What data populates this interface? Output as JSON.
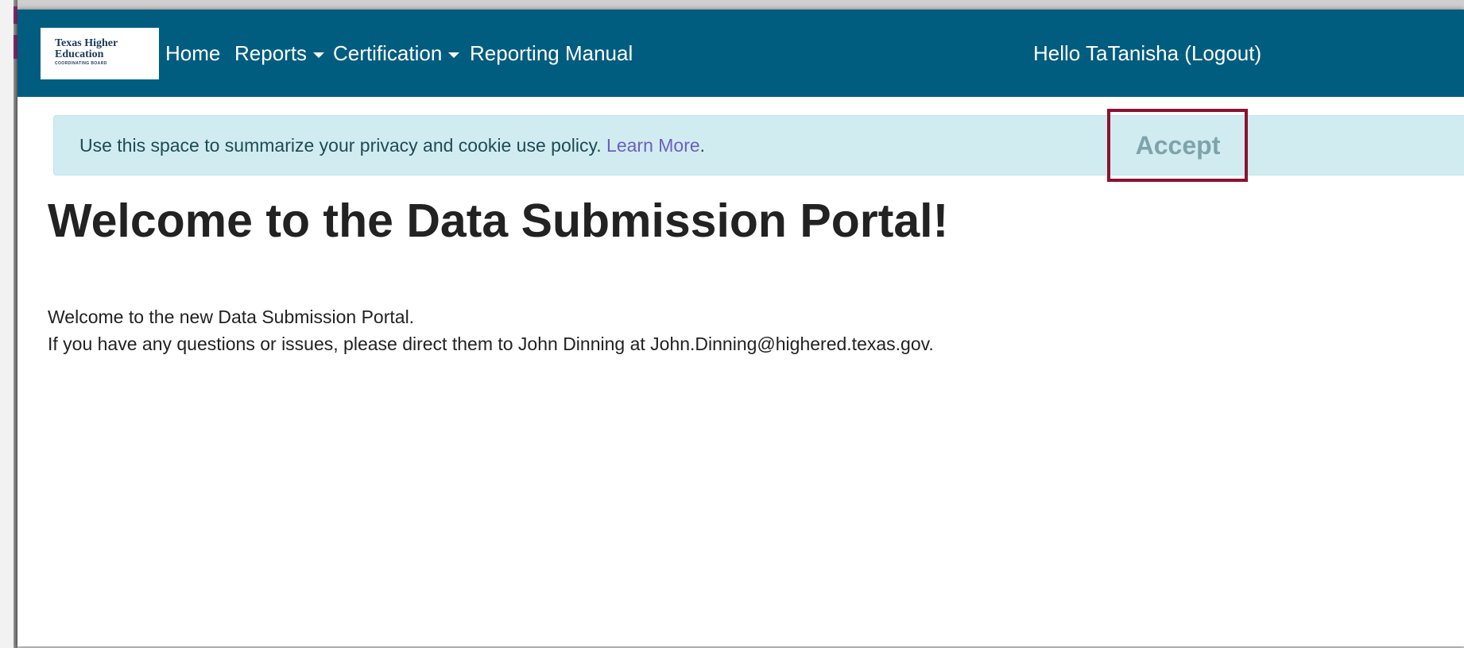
{
  "header": {
    "logo": {
      "line1": "Texas Higher",
      "line2": "Education",
      "line3": "COORDINATING BOARD"
    },
    "nav": {
      "home": "Home",
      "reports": "Reports",
      "certification": "Certification",
      "reporting_manual": "Reporting Manual"
    },
    "greeting": "Hello TaTanisha (Logout)",
    "icons": {
      "reports_dropdown": "caret-down-icon",
      "certification_dropdown": "caret-down-icon"
    }
  },
  "cookie_banner": {
    "message": "Use this space to summarize your privacy and cookie use policy.",
    "link_label": "Learn More",
    "trailing": ".",
    "accept_label": "Accept"
  },
  "main": {
    "title": "Welcome to the Data Submission Portal!",
    "line1": "Welcome to the new Data Submission Portal.",
    "line2": "If you have any questions or issues, please direct them to John Dinning at John.Dinning@highered.texas.gov."
  },
  "colors": {
    "navbar": "#005d7f",
    "cookie_bar": "#d1ecf1",
    "highlight_border": "#8b1230",
    "link": "#6a5fc3"
  }
}
